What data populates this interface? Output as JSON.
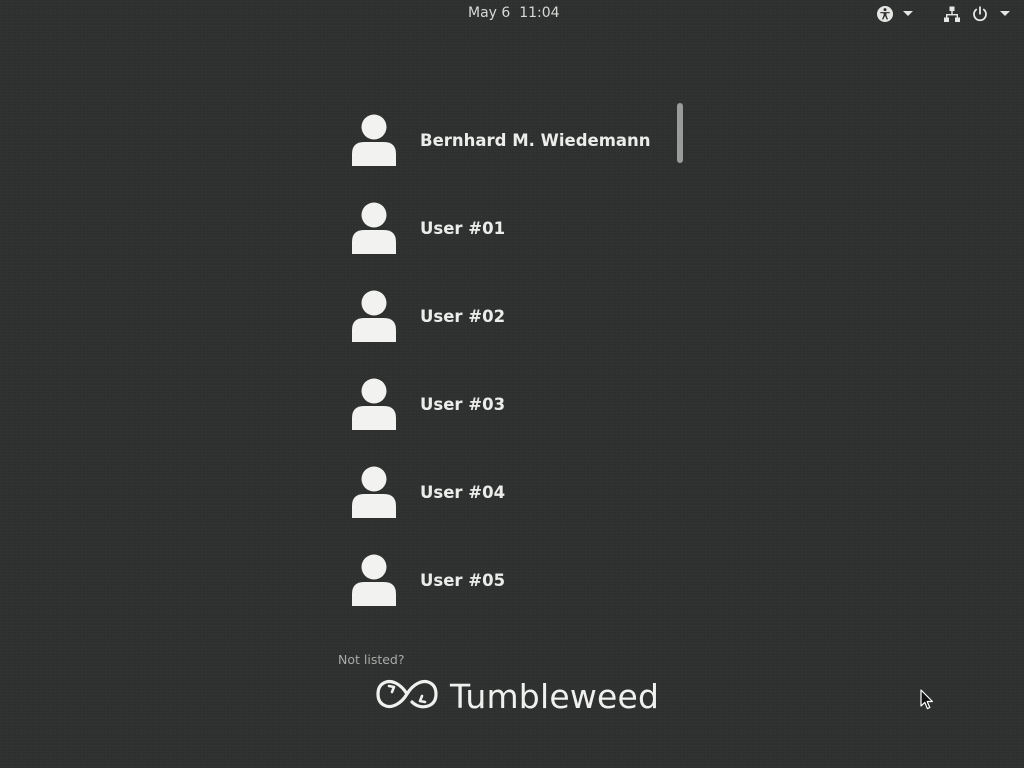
{
  "topbar": {
    "clock": "May 6  11:04",
    "icons": [
      "accessibility-icon",
      "network-icon",
      "power-icon"
    ]
  },
  "users": [
    {
      "name": "Bernhard M. Wiedemann"
    },
    {
      "name": "User #01"
    },
    {
      "name": "User #02"
    },
    {
      "name": "User #03"
    },
    {
      "name": "User #04"
    },
    {
      "name": "User #05"
    }
  ],
  "not_listed_label": "Not listed?",
  "brand": {
    "name": "Tumbleweed"
  },
  "colors": {
    "background": "#2d302f",
    "text": "#eeeeec",
    "muted_text": "#a7a9a6",
    "scrollbar": "#9a9c9a"
  }
}
